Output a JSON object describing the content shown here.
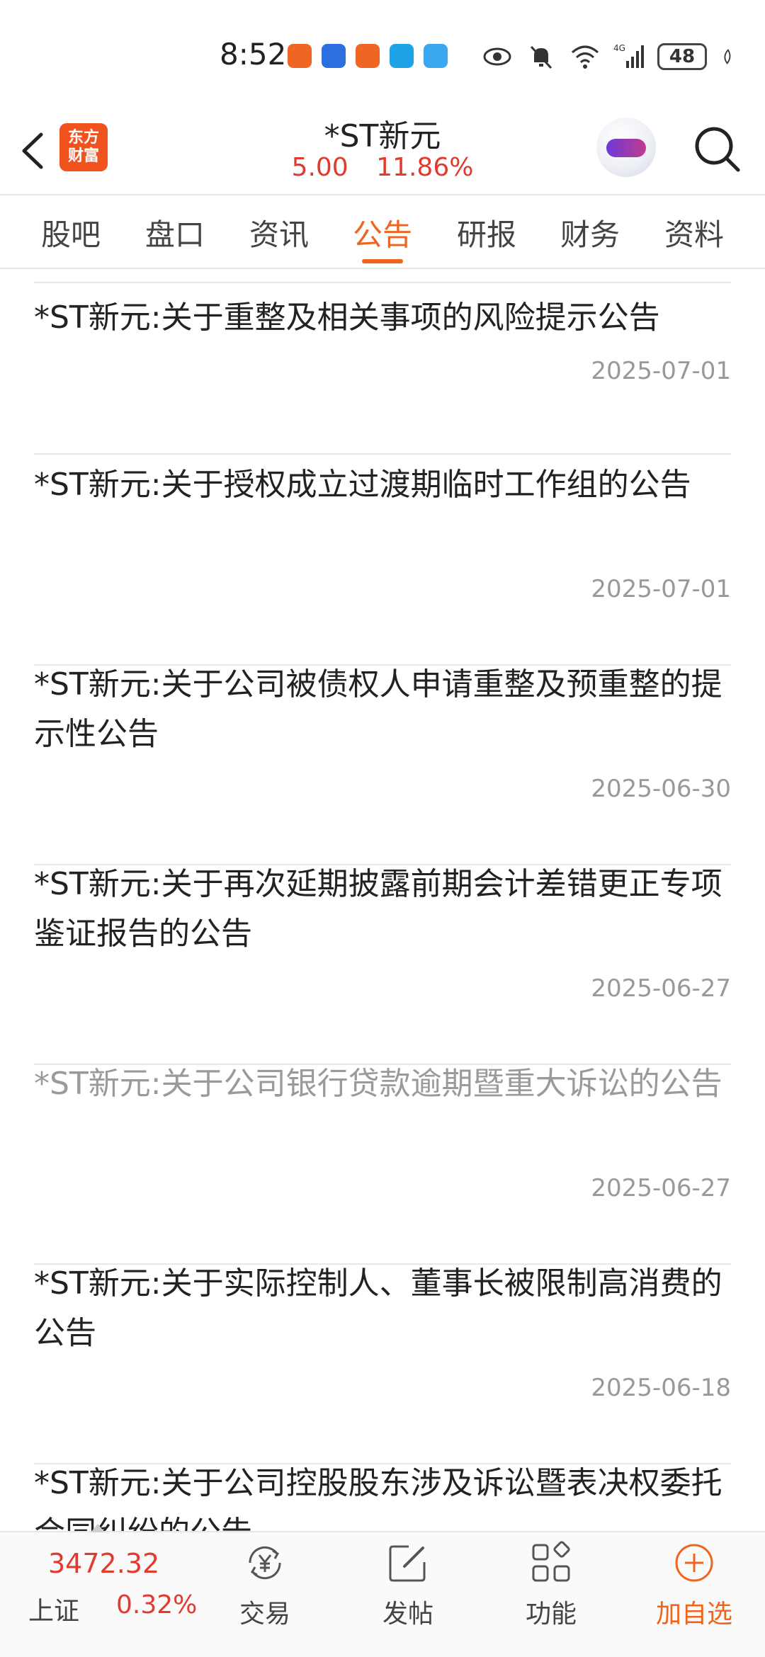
{
  "status_bar": {
    "time": "8:52",
    "battery": "48",
    "signal": "4G"
  },
  "header": {
    "logo_line1": "东方",
    "logo_line2": "财富",
    "stock_name": "*ST新元",
    "price": "5.00",
    "change_pct": "11.86%"
  },
  "tabs": [
    {
      "label": "股吧"
    },
    {
      "label": "盘口"
    },
    {
      "label": "资讯"
    },
    {
      "label": "公告",
      "active": true
    },
    {
      "label": "研报"
    },
    {
      "label": "财务"
    },
    {
      "label": "资料"
    }
  ],
  "announcements": [
    {
      "title": "*ST新元:关于重整及相关事项的风险提示公告",
      "date": "2025-07-01",
      "read": false
    },
    {
      "title": "*ST新元:关于授权成立过渡期临时工作组的公告",
      "date": "2025-07-01",
      "read": false
    },
    {
      "title": "*ST新元:关于公司被债权人申请重整及预重整的提示性公告",
      "date": "2025-06-30",
      "read": false
    },
    {
      "title": "*ST新元:关于再次延期披露前期会计差错更正专项鉴证报告的公告",
      "date": "2025-06-27",
      "read": false
    },
    {
      "title": "*ST新元:关于公司银行贷款逾期暨重大诉讼的公告",
      "date": "2025-06-27",
      "read": true
    },
    {
      "title": "*ST新元:关于实际控制人、董事长被限制高消费的公告",
      "date": "2025-06-18",
      "read": false
    },
    {
      "title": "*ST新元:关于公司控股股东涉及诉讼暨表决权委托合同纠纷的公告",
      "date": "",
      "read": false
    }
  ],
  "bottom_nav": {
    "index_value": "3472.32",
    "index_name": "上证",
    "index_change": "0.32%",
    "trade_label": "交易",
    "post_label": "发帖",
    "features_label": "功能",
    "add_watch_label": "加自选"
  },
  "colors": {
    "accent": "#f0641e",
    "up": "#e23a2e"
  }
}
